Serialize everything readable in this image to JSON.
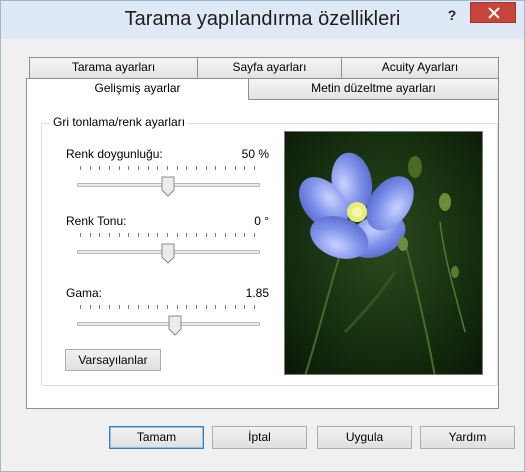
{
  "window": {
    "title": "Tarama yapılandırma özellikleri",
    "help_label": "?",
    "close_icon": "close-icon"
  },
  "tabs": {
    "row1": [
      "Tarama ayarları",
      "Sayfa ayarları",
      "Acuity Ayarları"
    ],
    "row2": [
      "Gelişmiş ayarlar",
      "Metin düzeltme ayarları"
    ],
    "active": "Gelişmiş ayarlar"
  },
  "group": {
    "label": "Gri tonlama/renk ayarları",
    "sliders": [
      {
        "label": "Renk doygunluğu:",
        "value": "50 %",
        "position": 0.5
      },
      {
        "label": "Renk Tonu:",
        "value": "0 °",
        "position": 0.5
      },
      {
        "label": "Gama:",
        "value": "1.85",
        "position": 0.55
      }
    ],
    "defaults_button": "Varsayılanlar"
  },
  "preview": {
    "icon": "flower-preview-image"
  },
  "footer": {
    "ok": "Tamam",
    "cancel": "İptal",
    "apply": "Uygula",
    "help": "Yardım"
  },
  "colors": {
    "title_bg": "#dfe9f5",
    "close_bg": "#c7443a",
    "accent": "#3c7fb1"
  }
}
